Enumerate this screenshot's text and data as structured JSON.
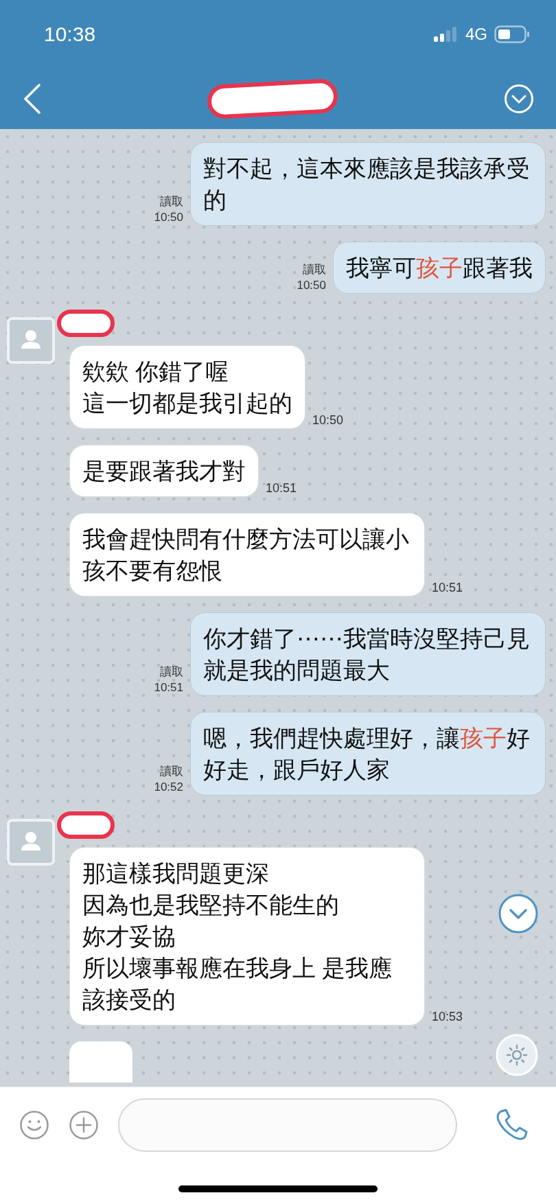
{
  "status_bar": {
    "time": "10:38",
    "network": "4G"
  },
  "messages": [
    {
      "kind": "sent",
      "lines": [
        "對不起，這本來應該是我該承受的"
      ],
      "read_label": "讀取",
      "time": "10:50"
    },
    {
      "kind": "sent",
      "segments": [
        {
          "text": "我寧可"
        },
        {
          "text": "孩子",
          "color": "#e0533a"
        },
        {
          "text": "跟著我"
        }
      ],
      "read_label": "讀取",
      "time": "10:50"
    },
    {
      "kind": "received",
      "avatar": true,
      "lines": [
        "欸欸 你錯了喔",
        "這一切都是我引起的"
      ],
      "time": "10:50"
    },
    {
      "kind": "received",
      "avatar": false,
      "lines": [
        "是要跟著我才對"
      ],
      "time": "10:51"
    },
    {
      "kind": "received",
      "avatar": false,
      "lines": [
        "我會趕快問有什麼方法可以讓小孩不要有怨恨"
      ],
      "time": "10:51"
    },
    {
      "kind": "sent",
      "lines": [
        "你才錯了⋯⋯我當時沒堅持己見就是我的問題最大"
      ],
      "read_label": "讀取",
      "time": "10:51"
    },
    {
      "kind": "sent",
      "segments": [
        {
          "text": "嗯，我們趕快處理好，讓"
        },
        {
          "text": "孩子",
          "color": "#e0533a"
        },
        {
          "text": "好好走，跟戶好人家"
        }
      ],
      "read_label": "讀取",
      "time": "10:52"
    },
    {
      "kind": "received",
      "avatar": true,
      "lines": [
        "那這樣我問題更深",
        "因為也是我堅持不能生的",
        "妳才妥協",
        "所以壞事報應在我身上 是我應該接受的"
      ],
      "time": "10:53"
    },
    {
      "kind": "partial"
    }
  ]
}
